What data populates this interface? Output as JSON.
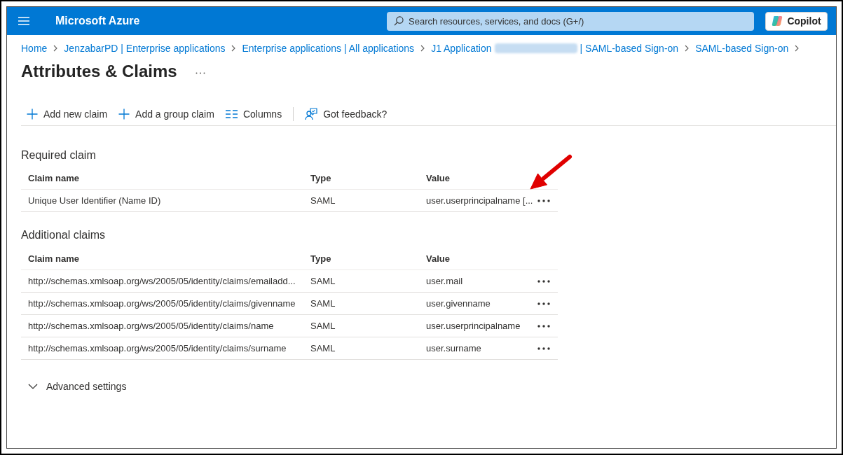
{
  "top_bar": {
    "title": "Microsoft Azure",
    "search": {
      "placeholder": "Search resources, services, and docs (G+/)"
    },
    "copilot": {
      "label": "Copilot"
    }
  },
  "breadcrumb": [
    {
      "label": "Home"
    },
    {
      "label": "JenzabarPD | Enterprise applications"
    },
    {
      "label": "Enterprise applications | All applications"
    },
    {
      "label": "J1 Application",
      "redacted": true,
      "label_after": "| SAML-based Sign-on"
    },
    {
      "label": "SAML-based Sign-on"
    }
  ],
  "page": {
    "title": "Attributes & Claims"
  },
  "toolbar": [
    {
      "kind": "add",
      "label": "Add new claim"
    },
    {
      "kind": "add",
      "label": "Add a group claim"
    },
    {
      "kind": "columns",
      "label": "Columns"
    },
    {
      "kind": "feedback",
      "label": "Got feedback?"
    }
  ],
  "required_claim": {
    "heading": "Required claim",
    "columns": [
      "Claim name",
      "Type",
      "Value"
    ],
    "rows": [
      {
        "claim_name": "Unique User Identifier (Name ID)",
        "type": "SAML",
        "value": "user.userprincipalname [..."
      }
    ]
  },
  "additional_claims": {
    "heading": "Additional claims",
    "columns": [
      "Claim name",
      "Type",
      "Value"
    ],
    "rows": [
      {
        "claim_name": "http://schemas.xmlsoap.org/ws/2005/05/identity/claims/emailadd...",
        "type": "SAML",
        "value": "user.mail"
      },
      {
        "claim_name": "http://schemas.xmlsoap.org/ws/2005/05/identity/claims/givenname",
        "type": "SAML",
        "value": "user.givenname"
      },
      {
        "claim_name": "http://schemas.xmlsoap.org/ws/2005/05/identity/claims/name",
        "type": "SAML",
        "value": "user.userprincipalname"
      },
      {
        "claim_name": "http://schemas.xmlsoap.org/ws/2005/05/identity/claims/surname",
        "type": "SAML",
        "value": "user.surname"
      }
    ]
  },
  "advanced_settings": {
    "label": "Advanced settings",
    "expanded": false
  },
  "annotations": [
    {
      "kind": "arrow"
    }
  ]
}
